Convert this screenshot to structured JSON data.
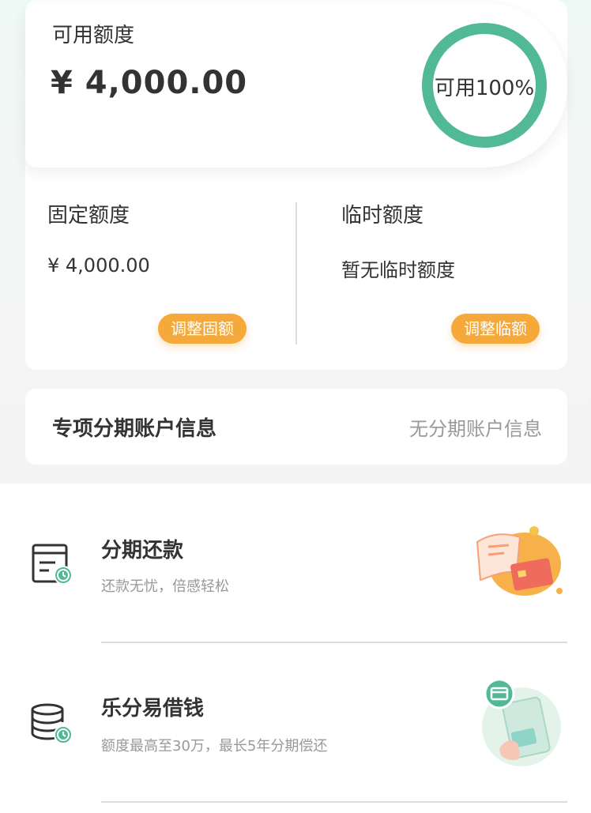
{
  "credit": {
    "available_label": "可用额度",
    "available_amount": "¥ 4,000.00",
    "ring_text": "可用100%",
    "available_percent": 100,
    "fixed_label": "固定额度",
    "fixed_amount": "¥ 4,000.00",
    "adjust_fixed_label": "调整固额",
    "temp_label": "临时额度",
    "temp_value": "暂无临时额度",
    "adjust_temp_label": "调整临额"
  },
  "installment_account": {
    "label": "专项分期账户信息",
    "value": "无分期账户信息"
  },
  "services": [
    {
      "title": "分期还款",
      "subtitle": "还款无忧，倍感轻松",
      "icon": "bill-clock-icon",
      "illustration": "card-bill-illustration"
    },
    {
      "title": "乐分易借钱",
      "subtitle": "额度最高至30万，最长5年分期偿还",
      "icon": "coins-clock-icon",
      "illustration": "phone-money-illustration"
    }
  ],
  "colors": {
    "accent_green": "#52b996",
    "button_orange": "#f5a93b",
    "text_primary": "#333333",
    "text_secondary": "#999999"
  }
}
